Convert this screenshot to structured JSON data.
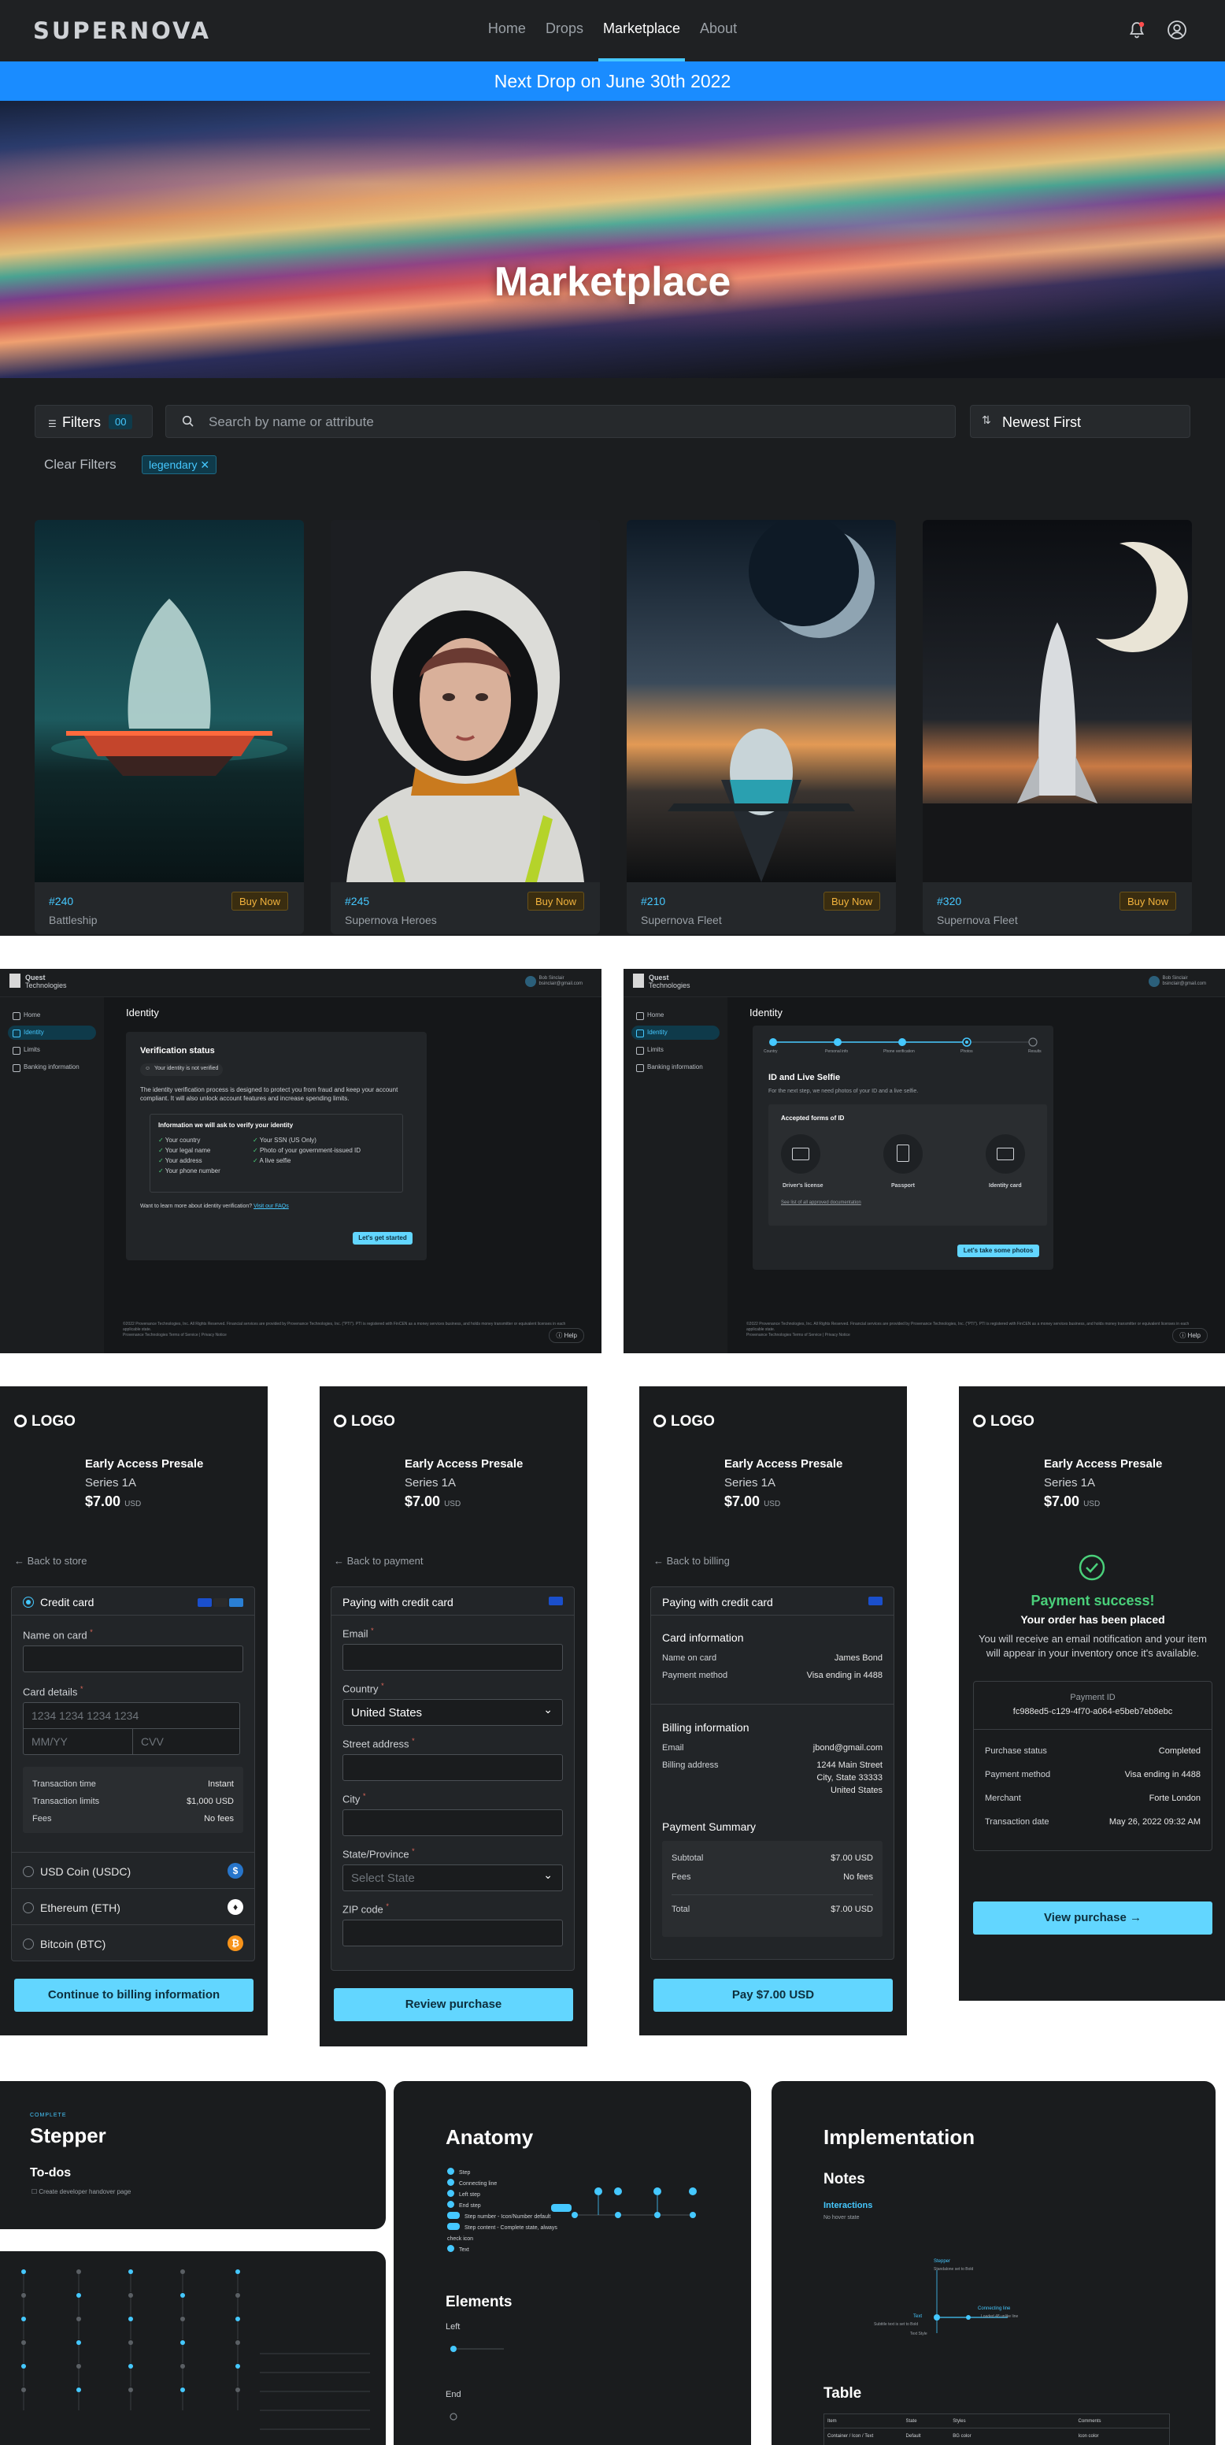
{
  "colors": {
    "accent": "#45c8ff",
    "banner": "#1a8cff",
    "buy": "#f2b33d",
    "success": "#4ad07a",
    "cta": "#62d6ff"
  },
  "market": {
    "brand": "SUPERNOVA",
    "nav": [
      "Home",
      "Drops",
      "Marketplace",
      "About"
    ],
    "active_nav": "Marketplace",
    "banner": "Next Drop on June 30th 2022",
    "hero_title": "Marketplace",
    "filters_label": "Filters",
    "filters_count": "00",
    "search_placeholder": "Search by name or attribute",
    "sort_label": "Newest First",
    "clear_filters": "Clear Filters",
    "chip": "legendary",
    "cards": [
      {
        "id": "#240",
        "name": "Battleship",
        "buy": "Buy Now"
      },
      {
        "id": "#245",
        "name": "Supernova Heroes",
        "buy": "Buy Now"
      },
      {
        "id": "#210",
        "name": "Supernova Fleet",
        "buy": "Buy Now"
      },
      {
        "id": "#320",
        "name": "Supernova Fleet",
        "buy": "Buy Now"
      }
    ]
  },
  "identity": {
    "brand_line1": "Quest",
    "brand_line2": "Technologies",
    "user_name": "Bob Sinclair",
    "user_email": "bsinclair@gmail.com",
    "sidebar": [
      "Home",
      "Identity",
      "Limits",
      "Banking information"
    ],
    "title": "Identity",
    "left": {
      "status_title": "Verification status",
      "status_badge": "Your identity is not verified",
      "description": "The identity verification process is designed to protect you from fraud and keep your account compliant. It will also unlock account features and increase spending limits.",
      "info_title": "Information we will ask to verify your identity",
      "items_col1": [
        "Your country",
        "Your legal name",
        "Your address",
        "Your phone number"
      ],
      "items_col2": [
        "Your SSN (US Only)",
        "Photo of your government-issued ID",
        "A live selfie"
      ],
      "faq_text": "Want to learn more about identity verification?",
      "faq_link": "Visit our FAQs",
      "cta": "Let's get started"
    },
    "right": {
      "steps": [
        "Country",
        "Personal info",
        "Phone verification",
        "Photos",
        "Results"
      ],
      "section_title": "ID and Live Selfie",
      "section_sub": "For the next step, we need photos of your ID and a live selfie.",
      "accepted_title": "Accepted forms of ID",
      "docs": [
        "Driver's license",
        "Passport",
        "Identity card"
      ],
      "list_link": "See list of all approved documentation",
      "cta": "Let's take some photos"
    },
    "footer": "©2022 Provenance Technologies, Inc. All Rights Reserved. Financial services are provided by Provenance Technologies, Inc. (\"PTI\"). PTI is registered with FinCEN as a money services business, and holds money transmitter or equivalent licenses in each applicable state.",
    "footer_links": "Provenance Technologies  Terms of Service  |  Privacy Notice",
    "help": "Help"
  },
  "checkout": {
    "logo": "LOGO",
    "presale": "Early Access Presale",
    "series": "Series 1A",
    "price": "$7.00",
    "currency": "USD",
    "s1": {
      "back": "Back to store",
      "method": "Credit card",
      "name_label": "Name on card",
      "card_label": "Card details",
      "card_ph": "1234 1234 1234 1234",
      "exp_ph": "MM/YY",
      "cvv_ph": "CVV",
      "rows": [
        [
          "Transaction time",
          "Instant"
        ],
        [
          "Transaction limits",
          "$1,000 USD"
        ],
        [
          "Fees",
          "No fees"
        ]
      ],
      "alts": [
        "USD Coin (USDC)",
        "Ethereum (ETH)",
        "Bitcoin (BTC)"
      ],
      "cta": "Continue to billing information"
    },
    "s2": {
      "back": "Back to payment",
      "method": "Paying with credit card",
      "email_label": "Email",
      "country_label": "Country",
      "country_value": "United States",
      "street_label": "Street address",
      "city_label": "City",
      "state_label": "State/Province",
      "state_ph": "Select State",
      "zip_label": "ZIP code",
      "cta": "Review purchase"
    },
    "s3": {
      "back": "Back to billing",
      "method": "Paying with credit card",
      "card_info": "Card information",
      "card_rows": [
        [
          "Name on card",
          "James Bond"
        ],
        [
          "Payment method",
          "Visa ending in 4488"
        ]
      ],
      "billing_info": "Billing information",
      "billing_email_label": "Email",
      "billing_email": "jbond@gmail.com",
      "billing_address_label": "Billing address",
      "billing_address": [
        "1244 Main Street",
        "City, State 33333",
        "United States"
      ],
      "summary": "Payment Summary",
      "summary_rows": [
        [
          "Subtotal",
          "$7.00 USD"
        ],
        [
          "Fees",
          "No fees"
        ]
      ],
      "total_label": "Total",
      "total": "$7.00 USD",
      "cta": "Pay $7.00 USD"
    },
    "s4": {
      "success": "Payment success!",
      "placed": "Your order has been placed",
      "message": "You will receive an email notification and your item will appear in your inventory once it's available.",
      "pid_label": "Payment ID",
      "pid": "fc988ed5-c129-4f70-a064-e5beb7eb8ebc",
      "rows": [
        [
          "Purchase status",
          "Completed"
        ],
        [
          "Payment method",
          "Visa ending in 4488"
        ],
        [
          "Merchant",
          "Forte London"
        ],
        [
          "Transaction date",
          "May 26, 2022 09:32 AM"
        ]
      ],
      "cta": "View purchase"
    }
  },
  "docs": {
    "tag": "COMPLETE",
    "stepper_title": "Stepper",
    "todos_title": "To-dos",
    "todo_item": "Create developer handover page",
    "anatomy_title": "Anatomy",
    "anatomy_items": [
      "Step",
      "Connecting line",
      "Left step",
      "End step",
      "Step number - Icon/Number default",
      "Step content - Complete state, always check icon",
      "Text"
    ],
    "elements_title": "Elements",
    "left_label": "Left",
    "end_label": "End",
    "impl_title": "Implementation",
    "notes_title": "Notes",
    "interactions_title": "Interactions",
    "interactions_sub": "No hover state",
    "diagram_labels": [
      "Stepper",
      "Standalone set to Bold",
      "Text",
      "Text Style",
      "Connecting line",
      "Loaded 48 unlike line",
      "Subtitle text is set to Bold"
    ],
    "table_title": "Table",
    "table_headers": [
      "Item",
      "State",
      "Styles",
      "Comments"
    ],
    "table_row": [
      "Container / Icon / Text",
      "Default",
      "BG color",
      "Icon color"
    ]
  }
}
